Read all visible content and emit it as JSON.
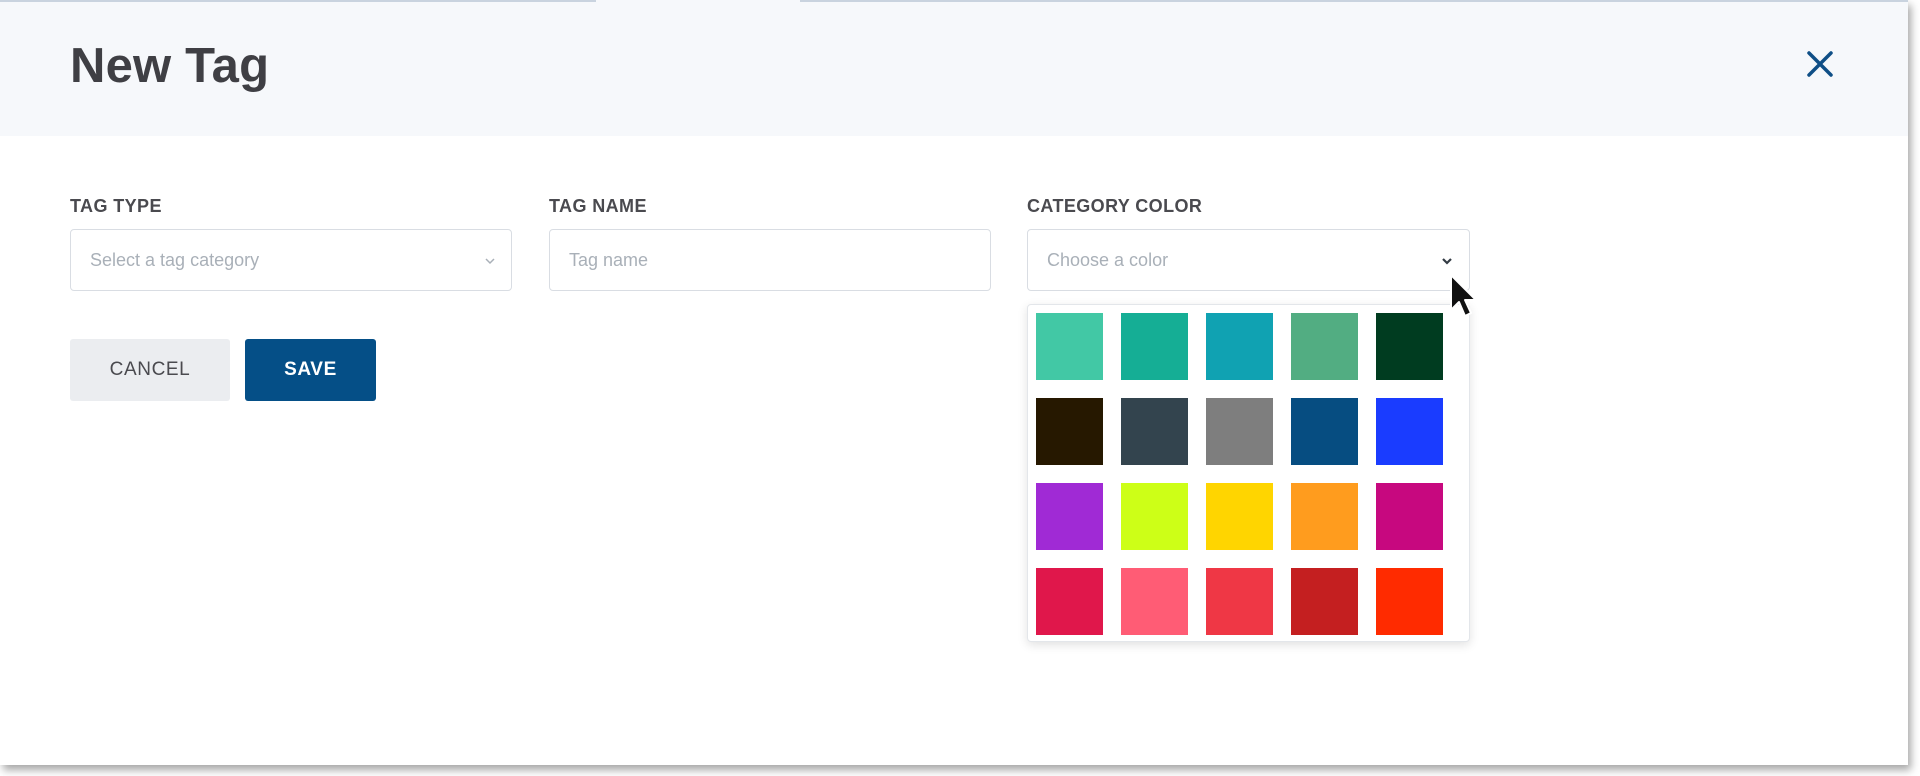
{
  "dialog": {
    "title": "New Tag"
  },
  "form": {
    "tag_type": {
      "label": "TAG TYPE",
      "placeholder": "Select a tag category"
    },
    "tag_name": {
      "label": "TAG NAME",
      "placeholder": "Tag name"
    },
    "category_color": {
      "label": "CATEGORY COLOR",
      "placeholder": "Choose a color"
    }
  },
  "actions": {
    "cancel_label": "CANCEL",
    "save_label": "SAVE"
  },
  "color_palette": [
    "#42c8a5",
    "#15ae95",
    "#10a2b2",
    "#52ad82",
    "#003c20",
    "#261800",
    "#33444e",
    "#7e7e7e",
    "#064d81",
    "#1a3cff",
    "#a02ad5",
    "#cdff17",
    "#ffd500",
    "#ff9c1e",
    "#c7087f",
    "#e0174b",
    "#ff5c75",
    "#ef3745",
    "#c41f20",
    "#ff2b00"
  ],
  "icons": {
    "close": "close-icon",
    "chevron": "chevron-down-icon",
    "cursor": "mouse-pointer-icon"
  },
  "colors": {
    "header_bg": "#f6f8fb",
    "primary": "#054f87",
    "title_text": "#3f3f44",
    "label_text": "#4a4a4f",
    "placeholder_text": "#a9b0b8"
  }
}
